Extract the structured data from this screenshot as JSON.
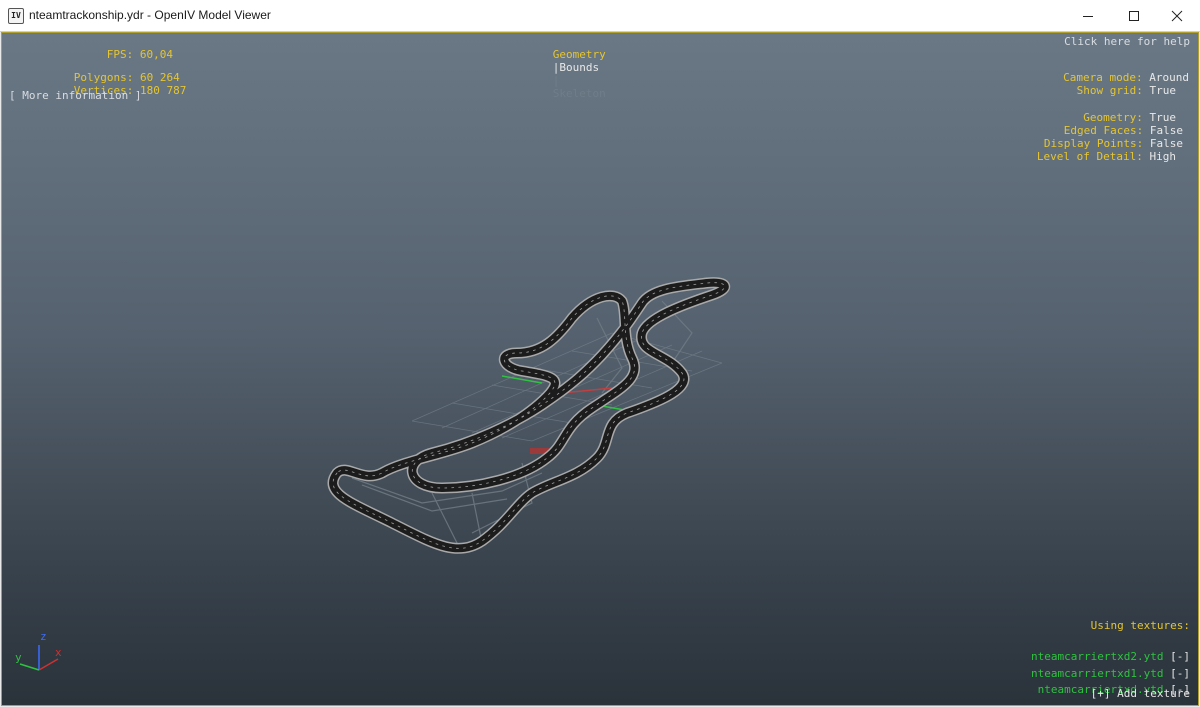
{
  "window": {
    "icon_text": "IV",
    "title": "nteamtrackonship.ydr - OpenIV Model Viewer"
  },
  "stats": {
    "fps_label": "FPS:",
    "fps_value": "60,04",
    "polygons_label": "Polygons:",
    "polygons_value": "60 264",
    "vertices_label": "Vertices:",
    "vertices_value": "180 787",
    "more_info": "[ More information ]"
  },
  "modes": {
    "geometry": "Geometry",
    "sep1": "|",
    "bounds": "Bounds",
    "sep2": "|",
    "skeleton": "Skeleton"
  },
  "help": "Click here for help",
  "settings": {
    "camera_mode_label": "Camera mode:",
    "camera_mode_value": "Around",
    "show_grid_label": "Show grid:",
    "show_grid_value": "True",
    "geometry_label": "Geometry:",
    "geometry_value": "True",
    "edged_faces_label": "Edged Faces:",
    "edged_faces_value": "False",
    "display_points_label": "Display Points:",
    "display_points_value": "False",
    "lod_label": "Level of Detail:",
    "lod_value": "High"
  },
  "textures": {
    "heading": "Using textures:",
    "items": [
      {
        "name": "nteamcarriertxd2.ytd",
        "remove": "[-]"
      },
      {
        "name": "nteamcarriertxd1.ytd",
        "remove": "[-]"
      },
      {
        "name": "nteamcarriertxd.ytd",
        "remove": "[-]"
      }
    ],
    "add": "[+] Add texture"
  },
  "axes": {
    "x": "x",
    "y": "y",
    "z": "z"
  },
  "colors": {
    "label": "#e5c531",
    "value": "#e8e8e8",
    "texture": "#2fc241",
    "inactive": "#6f7d89"
  }
}
